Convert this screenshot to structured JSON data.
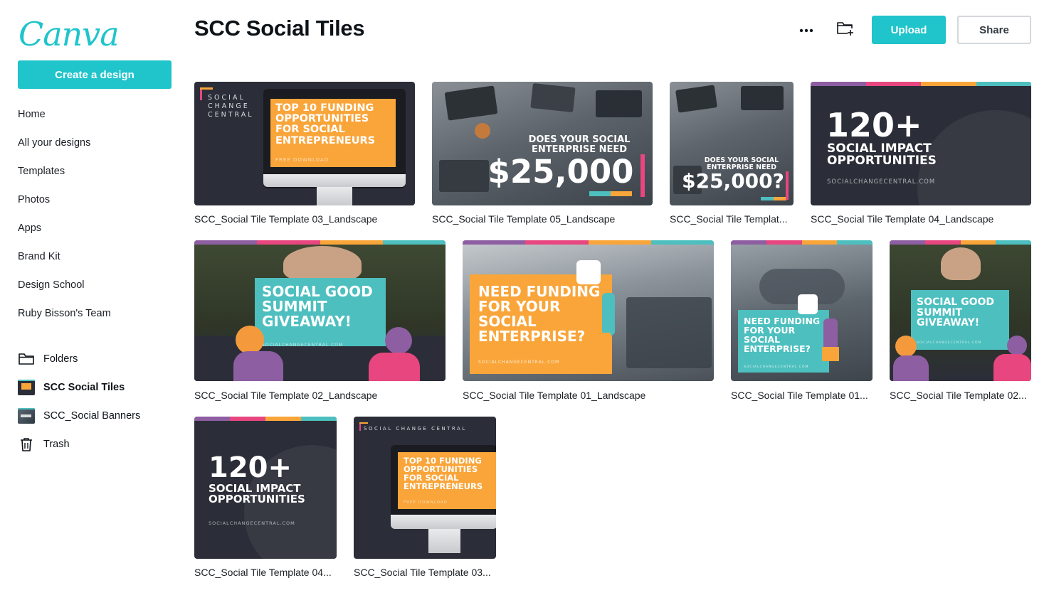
{
  "brand": {
    "logo_text": "Canva",
    "accent": "#20c4cb"
  },
  "sidebar": {
    "create_label": "Create a design",
    "nav": [
      "Home",
      "All your designs",
      "Templates",
      "Photos",
      "Apps",
      "Brand Kit",
      "Design School",
      "Ruby Bisson's Team"
    ],
    "folders": [
      {
        "label": "Folders",
        "icon": "folder-icon",
        "active": false
      },
      {
        "label": "SCC Social Tiles",
        "icon": "folder-thumbnail-icon",
        "active": true
      },
      {
        "label": "SCC_Social Banners",
        "icon": "folder-thumbnail-icon",
        "active": false
      },
      {
        "label": "Trash",
        "icon": "trash-icon",
        "active": false
      }
    ]
  },
  "header": {
    "title": "SCC Social Tiles",
    "more_icon": "more-icon",
    "new_folder_icon": "new-folder-icon",
    "upload_label": "Upload",
    "share_label": "Share"
  },
  "designs": [
    {
      "name": "SCC_Social Tile Template 03_Landscape",
      "art": {
        "brand": "SOCIAL CHANGE CENTRAL",
        "headline": "TOP 10 FUNDING OPPORTUNITIES FOR SOCIAL ENTREPRENEURS",
        "sub": "FREE DOWNLOAD"
      }
    },
    {
      "name": "SCC_Social Tile Template 05_Landscape",
      "art": {
        "headline": "DOES YOUR SOCIAL ENTERPRISE NEED",
        "amount": "$25,000"
      }
    },
    {
      "name": "SCC_Social Tile Templat...",
      "art": {
        "headline": "DOES YOUR SOCIAL ENTERPRISE NEED",
        "amount": "$25,000?"
      }
    },
    {
      "name": "SCC_Social Tile Template 04_Landscape",
      "art": {
        "number": "120+",
        "headline": "SOCIAL IMPACT OPPORTUNITIES",
        "sub": "SOCIALCHANGECENTRAL.COM"
      }
    },
    {
      "name": "SCC_Social Tile Template 02_Landscape",
      "art": {
        "headline": "SOCIAL GOOD SUMMIT GIVEAWAY!",
        "sub": "SOCIALCHANGECENTRAL.COM"
      }
    },
    {
      "name": "SCC_Social Tile Template 01_Landscape",
      "art": {
        "headline": "NEED FUNDING FOR YOUR SOCIAL ENTERPRISE?",
        "sub": "SOCIALCHANGECENTRAL.COM"
      }
    },
    {
      "name": "SCC_Social Tile Template 01...",
      "art": {
        "headline": "NEED FUNDING FOR YOUR SOCIAL ENTERPRISE?",
        "sub": "SOCIALCHANGECENTRAL.COM"
      }
    },
    {
      "name": "SCC_Social Tile Template 02...",
      "art": {
        "headline": "SOCIAL GOOD SUMMIT GIVEAWAY!",
        "sub": "SOCIALCHANGECENTRAL.COM"
      }
    },
    {
      "name": "SCC_Social Tile Template 04...",
      "art": {
        "number": "120+",
        "headline": "SOCIAL IMPACT OPPORTUNITIES",
        "sub": "SOCIALCHANGECENTRAL.COM"
      }
    },
    {
      "name": "SCC_Social Tile Template 03...",
      "art": {
        "brand": "SOCIAL CHANGE CENTRAL",
        "headline": "TOP 10 FUNDING OPPORTUNITIES FOR SOCIAL ENTREPRENEURS",
        "sub": "FREE DOWNLOAD"
      }
    }
  ],
  "colors": {
    "dark": "#2b2e38",
    "orange": "#f9a53a",
    "teal": "#4dbfbf",
    "purple": "#8e5ea2",
    "pink": "#e7467f"
  }
}
